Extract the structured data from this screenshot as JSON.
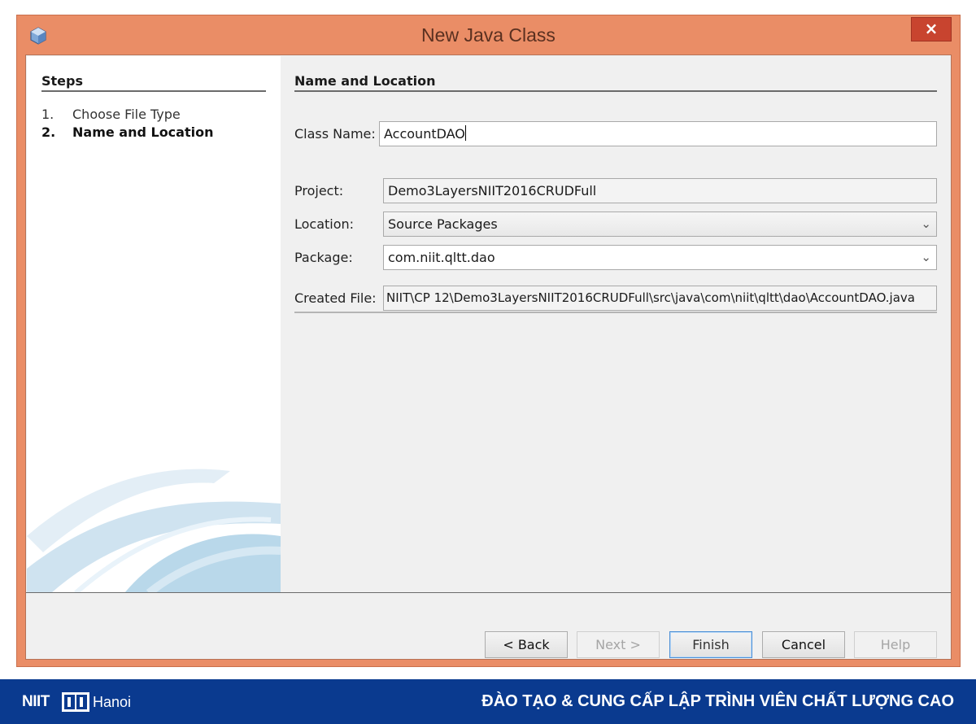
{
  "window": {
    "title": "New Java Class",
    "close_label": "×"
  },
  "steps": {
    "heading": "Steps",
    "items": [
      {
        "num": "1.",
        "label": "Choose File Type"
      },
      {
        "num": "2.",
        "label": "Name and Location"
      }
    ]
  },
  "form": {
    "section_title": "Name and Location",
    "class_name": {
      "label": "Class Name:",
      "value": "AccountDAO"
    },
    "project": {
      "label": "Project:",
      "value": "Demo3LayersNIIT2016CRUDFull"
    },
    "location": {
      "label": "Location:",
      "value": "Source Packages"
    },
    "package": {
      "label": "Package:",
      "value": "com.niit.qltt.dao"
    },
    "created_file": {
      "label": "Created File:",
      "value": "NIIT\\CP 12\\Demo3LayersNIIT2016CRUDFull\\src\\java\\com\\niit\\qltt\\dao\\AccountDAO.java"
    }
  },
  "buttons": {
    "back": "< Back",
    "next": "Next >",
    "finish": "Finish",
    "cancel": "Cancel",
    "help": "Help"
  },
  "footer": {
    "logo_brand": "NIIT",
    "logo_city": "Hanoi",
    "slogan": "ĐÀO TẠO & CUNG CẤP LẬP TRÌNH VIÊN CHẤT LƯỢNG CAO"
  },
  "colors": {
    "window_frame": "#ea8d66",
    "close_button": "#c8442f",
    "footer_bg": "#0a3a8f",
    "finish_focus": "#4c8fd6"
  },
  "icons": {
    "app": "netbeans-cube-icon",
    "close": "close-icon",
    "dropdown": "chevron-down-icon"
  }
}
